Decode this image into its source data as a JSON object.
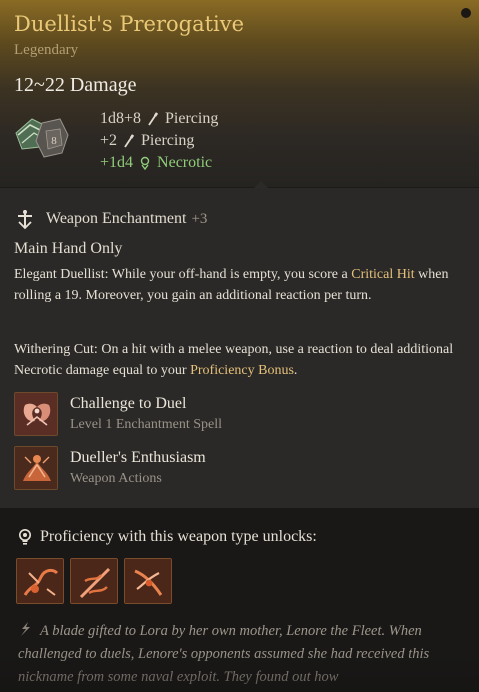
{
  "item": {
    "name": "Duellist's Prerogative",
    "rarity": "Legendary",
    "damage_total": "12~22 Damage",
    "damage_lines": [
      {
        "amount": "1d8+8",
        "type": "Piercing"
      },
      {
        "amount": "+2",
        "type": "Piercing"
      },
      {
        "amount": "+1d4",
        "type": "Necrotic"
      }
    ],
    "dice_badge_value": "8"
  },
  "enchantment": {
    "label": "Weapon Enchantment",
    "bonus": "+3",
    "main_hand": "Main Hand Only",
    "passive1": {
      "name": "Elegant Duellist:",
      "text1": " While your off-hand is empty, you score a ",
      "keyword": "Critical Hit",
      "text2": " when rolling a 19. Moreover, you gain an additional reaction per turn."
    },
    "passive2": {
      "name": "Withering Cut:",
      "text1": " On a hit with a melee weapon, use a reaction to deal additional Necrotic damage equal to your ",
      "keyword": "Proficiency Bonus",
      "text2": "."
    },
    "actions": [
      {
        "name": "Challenge to Duel",
        "subtitle": "Level 1 Enchantment Spell",
        "icon": "challenge-to-duel-icon"
      },
      {
        "name": "Dueller's Enthusiasm",
        "subtitle": "Weapon Actions",
        "icon": "duellers-enthusiasm-icon"
      }
    ]
  },
  "proficiency": {
    "label": "Proficiency with this weapon type unlocks:",
    "icons": [
      "weapon-action-1-icon",
      "weapon-action-2-icon",
      "weapon-action-3-icon"
    ]
  },
  "lore": "A blade gifted to Lora by her own mother, Lenore the Fleet. When challenged to duels, Lenore's opponents assumed she had received this nickname from some naval exploit. They found out how",
  "colors": {
    "title": "#e9c878",
    "necrotic": "#8fcd7a",
    "keyword": "#e4c07a",
    "icon_frame": "#7a4c2b"
  }
}
